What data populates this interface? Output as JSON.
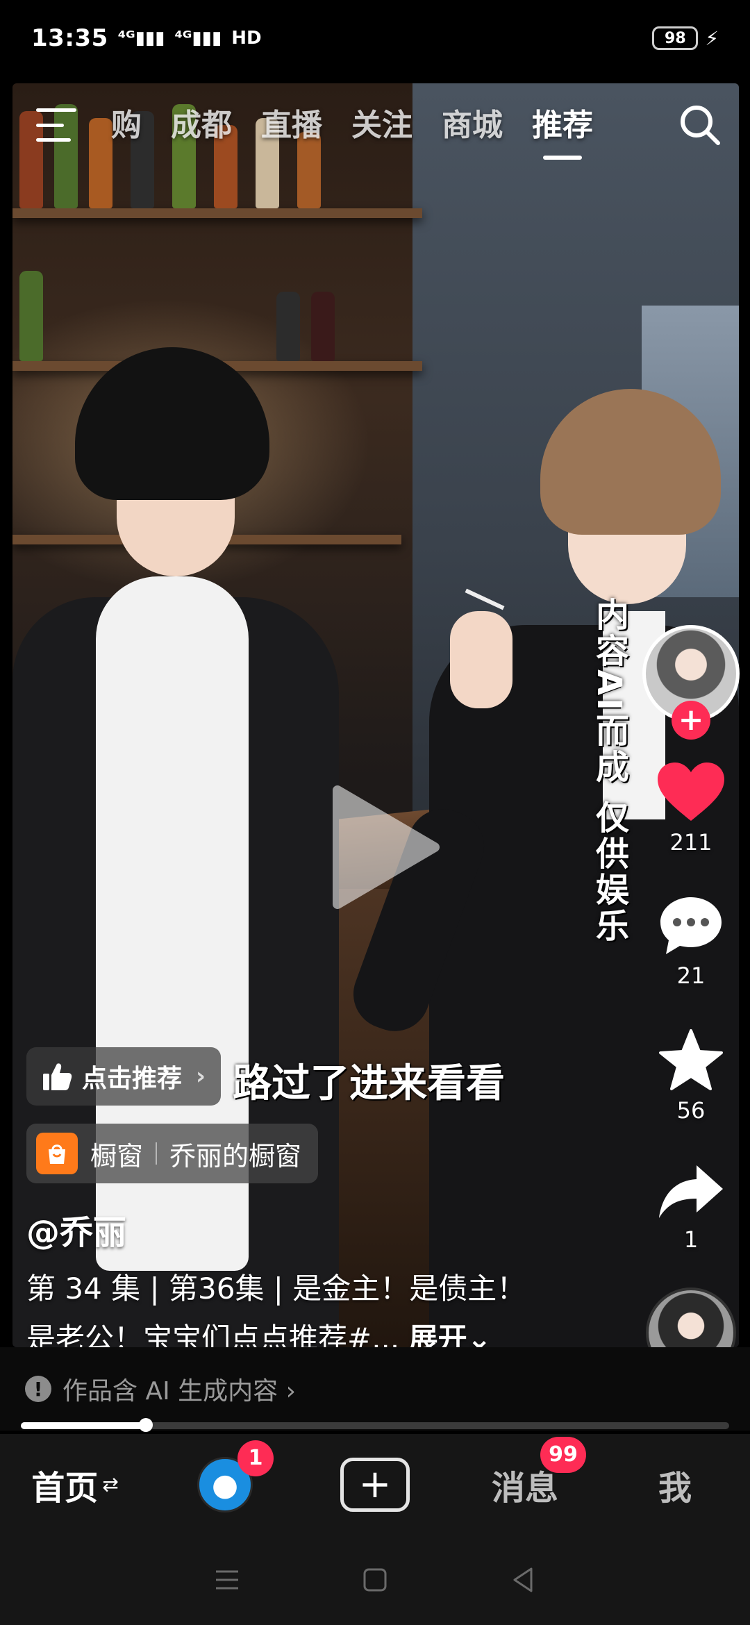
{
  "status_bar": {
    "time": "13:35",
    "signal_1": "⁴ᴳ▮▮▮",
    "signal_2": "⁴ᴳ▮▮▮",
    "hd_label": "HD",
    "battery": "98"
  },
  "top_nav": {
    "tabs": [
      "购",
      "成都",
      "直播",
      "关注",
      "商城",
      "推荐"
    ],
    "active_tab": "推荐"
  },
  "video": {
    "vertical_notice": "内容AI而成 仅供娱乐",
    "subtitle": "路过了进来看看"
  },
  "rail": {
    "like_count": "211",
    "comment_count": "21",
    "favorite_count": "56",
    "share_count": "1",
    "like_color": "#fe2c55"
  },
  "recommend_chip": {
    "label": "点击推荐"
  },
  "shop_chip": {
    "label": "橱窗",
    "shop_name": "乔丽的橱窗"
  },
  "caption": {
    "author": "@乔丽",
    "line1": "第 34 集 | 第36集 | 是金主！是债主！",
    "line2": "是老公！宝宝们点点推荐#...",
    "expand_label": "展开⌄"
  },
  "ai_notice": {
    "text": "作品含 AI 生成内容 ›"
  },
  "progress": {
    "fraction": 0.176
  },
  "bottom_nav": {
    "home_label": "首页",
    "friends_badge": "1",
    "messages_label": "消息",
    "messages_badge": "99",
    "me_label": "我"
  }
}
